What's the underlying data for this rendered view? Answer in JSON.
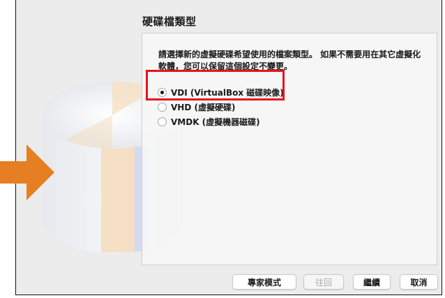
{
  "dialog": {
    "title": "硬碟檔類型",
    "description": "請選擇新的虛擬硬碟希望使用的檔案類型。 如果不需要用在其它虛擬化軟體，您可以保留這個設定不變更。"
  },
  "options": [
    {
      "label": "VDI (VirtualBox 磁碟映像)",
      "selected": true
    },
    {
      "label": "VHD (虛擬硬碟)",
      "selected": false
    },
    {
      "label": "VMDK (虛擬機器磁碟)",
      "selected": false
    }
  ],
  "buttons": {
    "expert": "專家模式",
    "back": "往回",
    "continue": "繼續",
    "cancel": "取消"
  },
  "colors": {
    "highlight": "#e8121a",
    "arrow": "#e67e22"
  }
}
